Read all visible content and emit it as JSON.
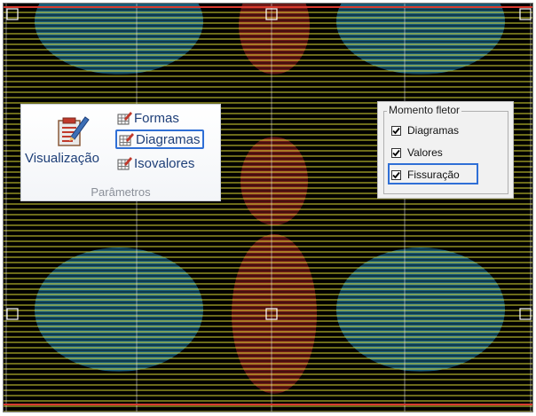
{
  "ribbon": {
    "visualizacao_label": "Visualização",
    "formas_label": "Formas",
    "diagramas_label": "Diagramas",
    "isovalores_label": "Isovalores",
    "group_label": "Parâmetros",
    "visualizacao_icon": "clipboard-pencil-icon",
    "small_icon": "grid-edit-icon"
  },
  "panel": {
    "group_title": "Momento fletor",
    "options": [
      {
        "label": "Diagramas",
        "checked": true
      },
      {
        "label": "Valores",
        "checked": true
      },
      {
        "label": "Fissuração",
        "checked": true
      }
    ]
  },
  "colors": {
    "background": "#000000",
    "contour_yellow": "#f2ef3a",
    "contour_cyan": "#2ea8d8",
    "contour_red": "#c8302a",
    "highlight": "#2f6fd6",
    "ribbon_text": "#1e3f78"
  }
}
